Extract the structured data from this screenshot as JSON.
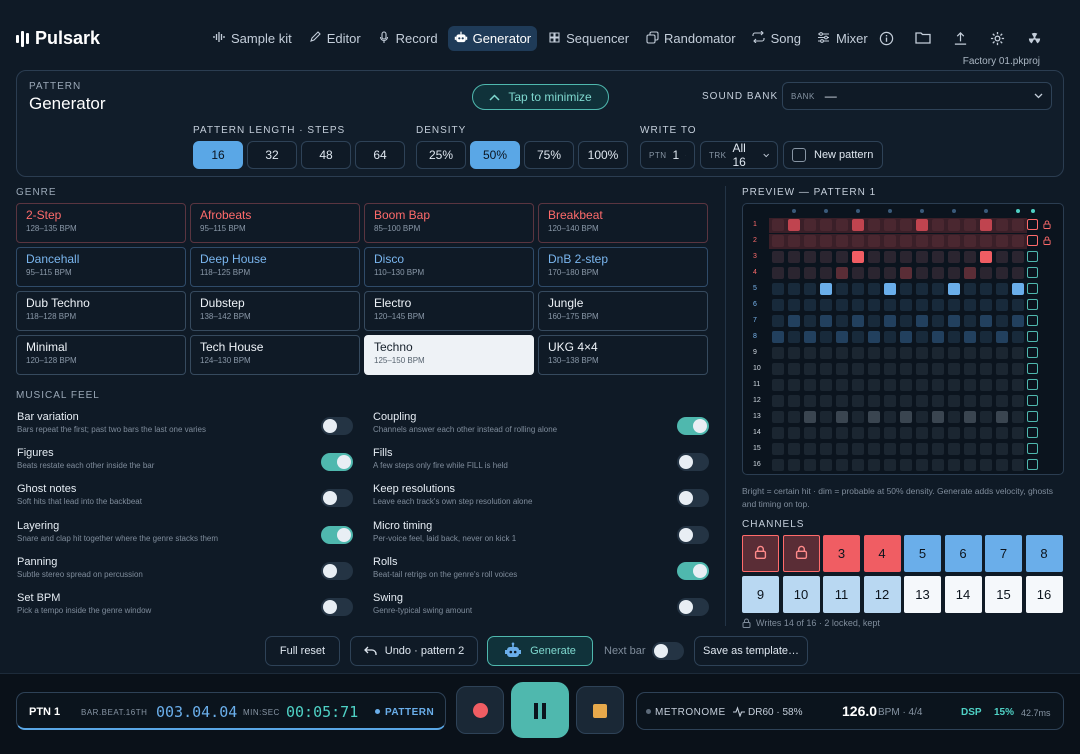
{
  "app": {
    "name": "Pulsark",
    "project_file": "Factory 01.pkproj"
  },
  "nav": [
    {
      "label": "Sample kit",
      "icon": "waveform-icon"
    },
    {
      "label": "Editor",
      "icon": "pencil-icon"
    },
    {
      "label": "Record",
      "icon": "microphone-icon"
    },
    {
      "label": "Generator",
      "icon": "robot-icon",
      "active": true
    },
    {
      "label": "Sequencer",
      "icon": "grid-icon"
    },
    {
      "label": "Randomator",
      "icon": "dice-icon"
    },
    {
      "label": "Song",
      "icon": "repeat-icon"
    },
    {
      "label": "Mixer",
      "icon": "sliders-icon"
    }
  ],
  "header_icons": [
    "info-icon",
    "folder-icon",
    "upload-icon",
    "settings-icon",
    "radiation-icon"
  ],
  "pattern_panel": {
    "kicker": "PATTERN",
    "title": "Generator",
    "minimize_label": "Tap to minimize",
    "sound_bank_label": "SOUND BANK",
    "bank_small": "BANK",
    "bank_value": "—",
    "length_label": "PATTERN LENGTH · STEPS",
    "lengths": [
      "16",
      "32",
      "48",
      "64"
    ],
    "length_selected": "16",
    "density_label": "DENSITY",
    "densities": [
      "25%",
      "50%",
      "75%",
      "100%"
    ],
    "density_selected": "50%",
    "write_label": "WRITE TO",
    "ptn_small": "PTN",
    "ptn_value": "1",
    "trk_small": "TRK",
    "trk_value": "All 16",
    "new_pattern_label": "New pattern"
  },
  "genre_label": "GENRE",
  "genres": [
    {
      "name": "2-Step",
      "bpm": "128–135 BPM",
      "style": "red"
    },
    {
      "name": "Afrobeats",
      "bpm": "95–115 BPM",
      "style": "red"
    },
    {
      "name": "Boom Bap",
      "bpm": "85–100 BPM",
      "style": "red"
    },
    {
      "name": "Breakbeat",
      "bpm": "120–140 BPM",
      "style": "red"
    },
    {
      "name": "Dancehall",
      "bpm": "95–115 BPM",
      "style": "blue"
    },
    {
      "name": "Deep House",
      "bpm": "118–125 BPM",
      "style": "blue"
    },
    {
      "name": "Disco",
      "bpm": "110–130 BPM",
      "style": "blue"
    },
    {
      "name": "DnB 2-step",
      "bpm": "170–180 BPM",
      "style": "blue"
    },
    {
      "name": "Dub Techno",
      "bpm": "118–128 BPM",
      "style": "white"
    },
    {
      "name": "Dubstep",
      "bpm": "138–142 BPM",
      "style": "white"
    },
    {
      "name": "Electro",
      "bpm": "120–145 BPM",
      "style": "white"
    },
    {
      "name": "Jungle",
      "bpm": "160–175 BPM",
      "style": "white"
    },
    {
      "name": "Minimal",
      "bpm": "120–128 BPM",
      "style": "white"
    },
    {
      "name": "Tech House",
      "bpm": "124–130 BPM",
      "style": "white"
    },
    {
      "name": "Techno",
      "bpm": "125–150 BPM",
      "style": "selected"
    },
    {
      "name": "UKG 4×4",
      "bpm": "130–138 BPM",
      "style": "white"
    }
  ],
  "feel_label": "MUSICAL FEEL",
  "feel_left": [
    {
      "title": "Bar variation",
      "desc": "Bars repeat the first; past two bars the last one varies",
      "on": false
    },
    {
      "title": "Figures",
      "desc": "Beats restate each other inside the bar",
      "on": true
    },
    {
      "title": "Ghost notes",
      "desc": "Soft hits that lead into the backbeat",
      "on": false
    },
    {
      "title": "Layering",
      "desc": "Snare and clap hit together where the genre stacks them",
      "on": true
    },
    {
      "title": "Panning",
      "desc": "Subtle stereo spread on percussion",
      "on": false
    },
    {
      "title": "Set BPM",
      "desc": "Pick a tempo inside the genre window",
      "on": false
    }
  ],
  "feel_right": [
    {
      "title": "Coupling",
      "desc": "Channels answer each other instead of rolling alone",
      "on": true
    },
    {
      "title": "Fills",
      "desc": "A few steps only fire while FILL is held",
      "on": false
    },
    {
      "title": "Keep resolutions",
      "desc": "Leave each track's own step resolution alone",
      "on": false
    },
    {
      "title": "Micro timing",
      "desc": "Per-voice feel, laid back, never on kick 1",
      "on": false
    },
    {
      "title": "Rolls",
      "desc": "Beat-tail retrigs on the genre's roll voices",
      "on": true
    },
    {
      "title": "Swing",
      "desc": "Genre-typical swing amount",
      "on": false
    }
  ],
  "preview": {
    "title": "PREVIEW — PATTERN 1",
    "rows": [
      "1",
      "2",
      "3",
      "4",
      "5",
      "6",
      "7",
      "8",
      "9",
      "10",
      "11",
      "12",
      "13",
      "14",
      "15",
      "16"
    ],
    "note": "Bright = certain hit · dim = probable at 50% density. Generate adds velocity, ghosts and timing on top."
  },
  "channels": {
    "label": "CHANNELS",
    "items": [
      {
        "label": "",
        "style": "locked",
        "icon": "lock-icon"
      },
      {
        "label": "",
        "style": "locked",
        "icon": "lock-icon"
      },
      {
        "label": "3",
        "style": "r"
      },
      {
        "label": "4",
        "style": "r"
      },
      {
        "label": "5",
        "style": "b"
      },
      {
        "label": "6",
        "style": "b"
      },
      {
        "label": "7",
        "style": "b"
      },
      {
        "label": "8",
        "style": "b"
      },
      {
        "label": "9",
        "style": "lb"
      },
      {
        "label": "10",
        "style": "lb"
      },
      {
        "label": "11",
        "style": "lb"
      },
      {
        "label": "12",
        "style": "lb"
      },
      {
        "label": "13",
        "style": "w"
      },
      {
        "label": "14",
        "style": "w"
      },
      {
        "label": "15",
        "style": "w"
      },
      {
        "label": "16",
        "style": "w"
      }
    ],
    "footer": "Writes 14 of 16 · 2 locked, kept"
  },
  "actions": {
    "full_reset": "Full reset",
    "undo": "Undo · pattern 2",
    "generate": "Generate",
    "next_bar": "Next bar",
    "save_template": "Save as template…"
  },
  "transport": {
    "ptn": "PTN 1",
    "pos_label": "BAR.BEAT.16TH",
    "pos_value": "003.04.04",
    "time_label": "MIN:SEC",
    "time_value": "00:05:71",
    "mode": "PATTERN",
    "metronome": "METRONOME",
    "dr": "DR60 · 58%",
    "bpm": "126.0",
    "bpm_unit": "BPM · 4/4",
    "dsp": "DSP",
    "dsp_pct": "15%",
    "latency": "42.7ms"
  },
  "colors": {
    "accent": "#4fb8ae",
    "red": "#f05d63",
    "blue": "#6aaeea",
    "bg": "#0f1a26"
  }
}
